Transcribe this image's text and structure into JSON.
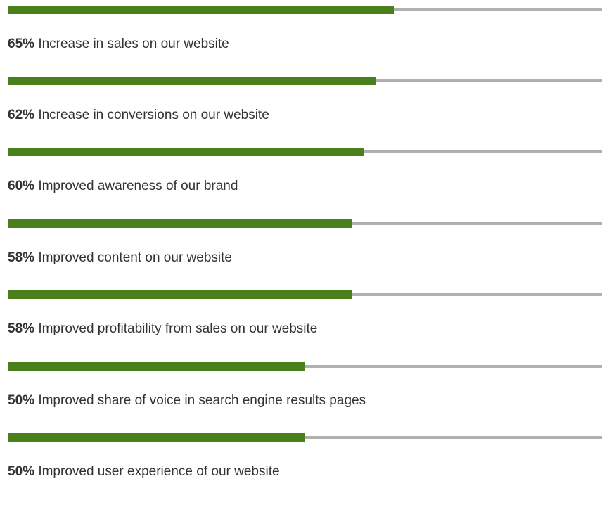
{
  "colors": {
    "fill": "#4a7f1c",
    "track": "#b0b0b0",
    "text": "#333333"
  },
  "chart_data": {
    "type": "bar",
    "orientation": "horizontal",
    "max": 100,
    "grid": false,
    "items": [
      {
        "value": 65,
        "percent_label": "65%",
        "text": "Increase in sales on our website"
      },
      {
        "value": 62,
        "percent_label": "62%",
        "text": "Increase in conversions on our website"
      },
      {
        "value": 60,
        "percent_label": "60%",
        "text": "Improved awareness of our brand"
      },
      {
        "value": 58,
        "percent_label": "58%",
        "text": "Improved content on our website"
      },
      {
        "value": 58,
        "percent_label": "58%",
        "text": "Improved profitability from sales on our website"
      },
      {
        "value": 50,
        "percent_label": "50%",
        "text": "Improved share of voice in search engine results pages"
      },
      {
        "value": 50,
        "percent_label": "50%",
        "text": "Improved user experience of our website"
      }
    ]
  }
}
